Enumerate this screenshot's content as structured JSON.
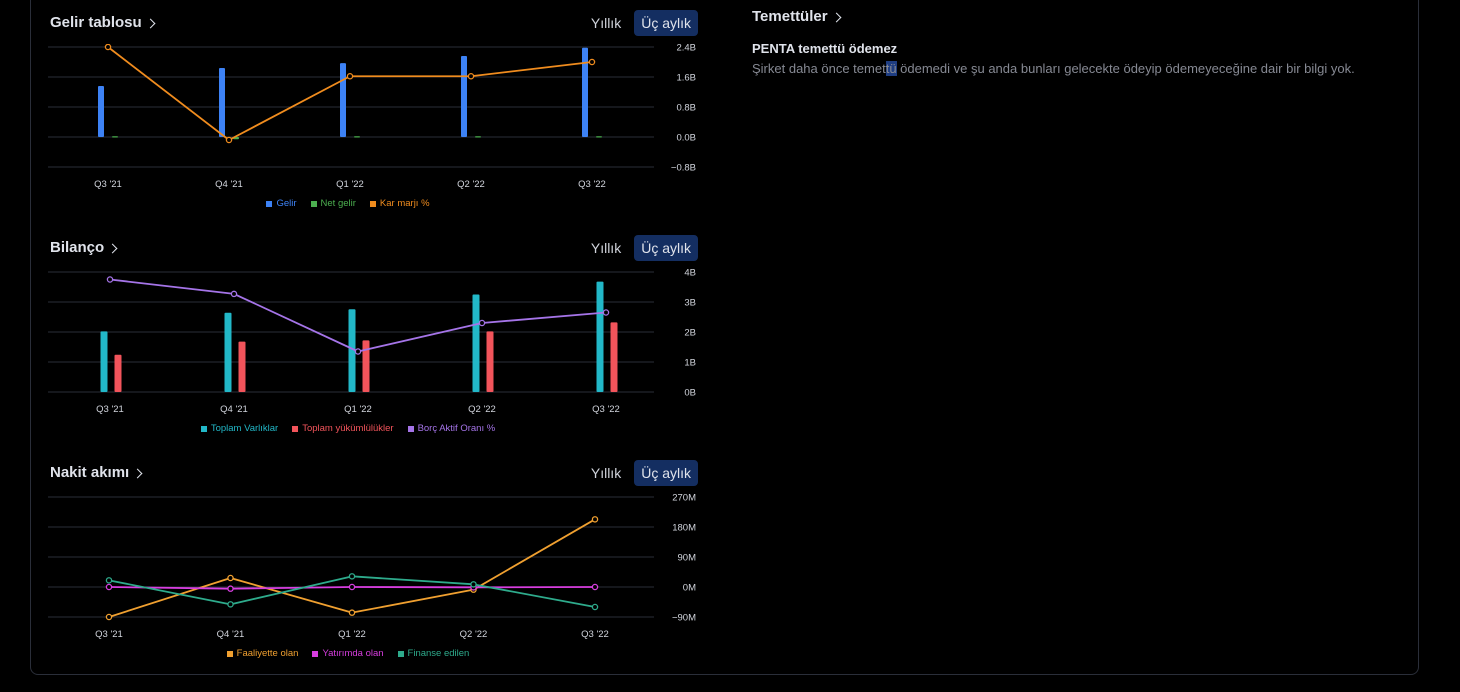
{
  "income": {
    "title": "Gelir tablosu",
    "tabs": [
      "Yıllık",
      "Üç aylık"
    ],
    "active_tab": "Üç aylık",
    "colors": {
      "revenue": "#3d82f5",
      "net": "#4caf50",
      "margin": "#f08c1e"
    },
    "legend": [
      "Gelir",
      "Net gelir",
      "Kar marjı %"
    ],
    "chart_data": {
      "type": "bar",
      "categories": [
        "Q3 '21",
        "Q4 '21",
        "Q1 '22",
        "Q2 '22",
        "Q3 '22"
      ],
      "y_ticks": [
        "2.4B",
        "1.6B",
        "0.8B",
        "0.0B",
        "−0.8B"
      ],
      "ylim": [
        -0.8,
        2.4
      ],
      "series": [
        {
          "name": "Gelir",
          "type": "bar",
          "values": [
            1.36,
            1.84,
            1.97,
            2.16,
            2.38
          ]
        },
        {
          "name": "Net gelir",
          "type": "bar",
          "values": [
            0.02,
            -0.06,
            0.02,
            0.02,
            0.02
          ]
        },
        {
          "name": "Kar marjı %",
          "type": "line",
          "values": [
            2.4,
            -0.08,
            1.62,
            1.62,
            2.0
          ]
        }
      ]
    }
  },
  "balance": {
    "title": "Bilanço",
    "tabs": [
      "Yıllık",
      "Üç aylık"
    ],
    "active_tab": "Üç aylık",
    "colors": {
      "assets": "#22b8c8",
      "liabilities": "#f2545b",
      "ratio": "#a574e8"
    },
    "legend": [
      "Toplam Varlıklar",
      "Toplam yükümlülükler",
      "Borç Aktif Oranı %"
    ],
    "chart_data": {
      "type": "bar",
      "categories": [
        "Q3 '21",
        "Q4 '21",
        "Q1 '22",
        "Q2 '22",
        "Q3 '22"
      ],
      "y_ticks": [
        "4B",
        "3B",
        "2B",
        "1B",
        "0B"
      ],
      "ylim": [
        0,
        4
      ],
      "series": [
        {
          "name": "Toplam Varlıklar",
          "type": "bar",
          "values": [
            2.02,
            2.64,
            2.76,
            3.25,
            3.68
          ]
        },
        {
          "name": "Toplam yükümlülükler",
          "type": "bar",
          "values": [
            1.24,
            1.68,
            1.72,
            2.02,
            2.32
          ]
        },
        {
          "name": "Borç Aktif Oranı %",
          "type": "line",
          "values": [
            3.75,
            3.27,
            1.35,
            2.3,
            2.65
          ]
        }
      ]
    }
  },
  "cashflow": {
    "title": "Nakit akımı",
    "tabs": [
      "Yıllık",
      "Üç aylık"
    ],
    "active_tab": "Üç aylık",
    "colors": {
      "operating": "#f0a030",
      "investing": "#d83ee0",
      "financing": "#2eab8c"
    },
    "legend": [
      "Faaliyette olan",
      "Yatırımda olan",
      "Finanse edilen"
    ],
    "chart_data": {
      "type": "line",
      "categories": [
        "Q3 '21",
        "Q4 '21",
        "Q1 '22",
        "Q2 '22",
        "Q3 '22"
      ],
      "y_ticks": [
        "270M",
        "180M",
        "90M",
        "0M",
        "−90M"
      ],
      "ylim": [
        -90,
        270
      ],
      "series": [
        {
          "name": "Faaliyette olan",
          "values": [
            -90,
            27,
            -77,
            -8,
            203
          ]
        },
        {
          "name": "Yatırımda olan",
          "values": [
            0,
            -5,
            0,
            -1,
            0
          ]
        },
        {
          "name": "Finanse edilen",
          "values": [
            20,
            -52,
            32,
            8,
            -60
          ]
        }
      ]
    }
  },
  "dividends": {
    "title": "Temettüler",
    "subtitle": "PENTA temettü ödemez",
    "text_before": "Şirket daha önce temet",
    "text_highlight": "tü",
    "text_after": " ödemedi ve şu anda bunları gelecekte ödeyip ödemeyeceğine dair bir bilgi yok."
  }
}
